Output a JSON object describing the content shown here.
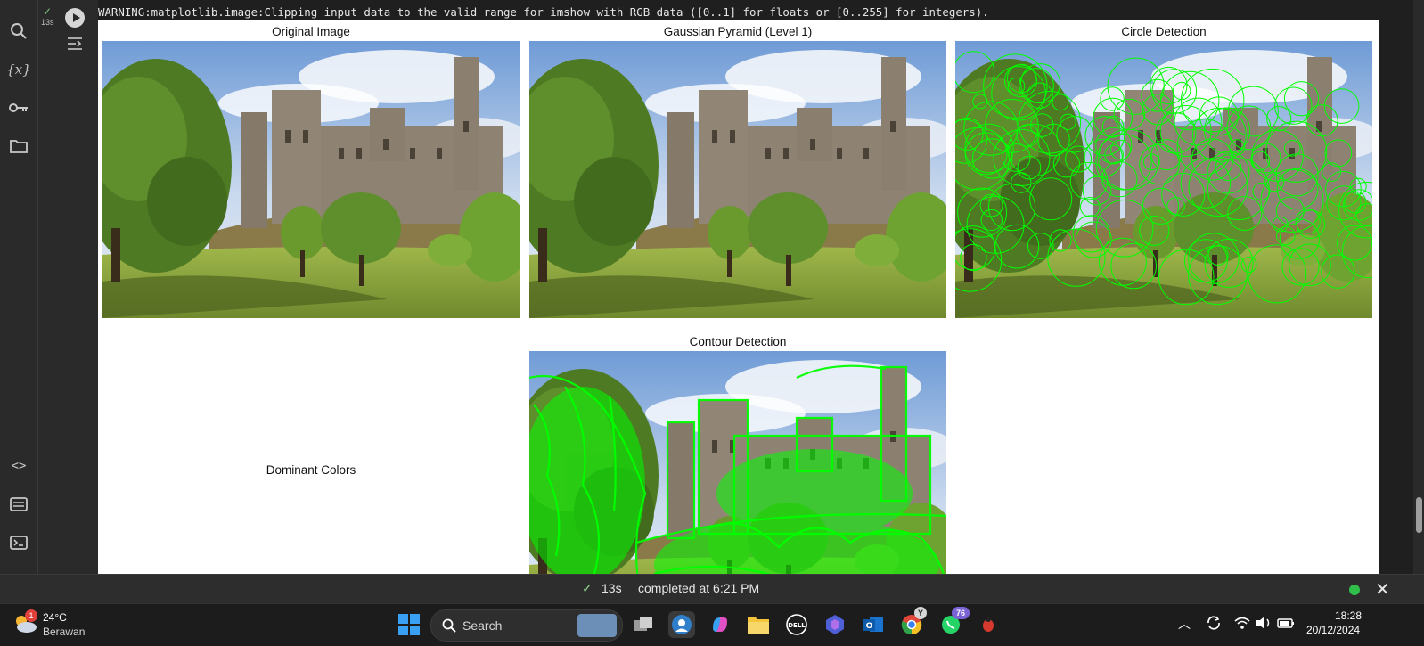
{
  "cell": {
    "status_check": "✓",
    "exec_time": "13s",
    "warning": "WARNING:matplotlib.image:Clipping input data to the valid range for imshow with RGB data ([0..1] for floats or [0..255] for integers)."
  },
  "plots": {
    "original": "Original Image",
    "pyramid": "Gaussian Pyramid (Level 1)",
    "circles": "Circle Detection",
    "dominant": "Dominant Colors",
    "contour": "Contour Detection"
  },
  "status_bar": {
    "check": "✓",
    "time": "13s",
    "message": "completed at 6:21 PM"
  },
  "taskbar": {
    "weather_temp": "24°C",
    "weather_desc": "Berawan",
    "weather_badge": "1",
    "search_placeholder": "Search",
    "chrome_badge": "Y",
    "whatsapp_badge": "76",
    "time": "18:28",
    "date": "20/12/2024"
  },
  "colors": {
    "accent_green": "#00ff00",
    "status_ok": "#2fbf4a",
    "editor_bg": "#1f1f1f"
  }
}
